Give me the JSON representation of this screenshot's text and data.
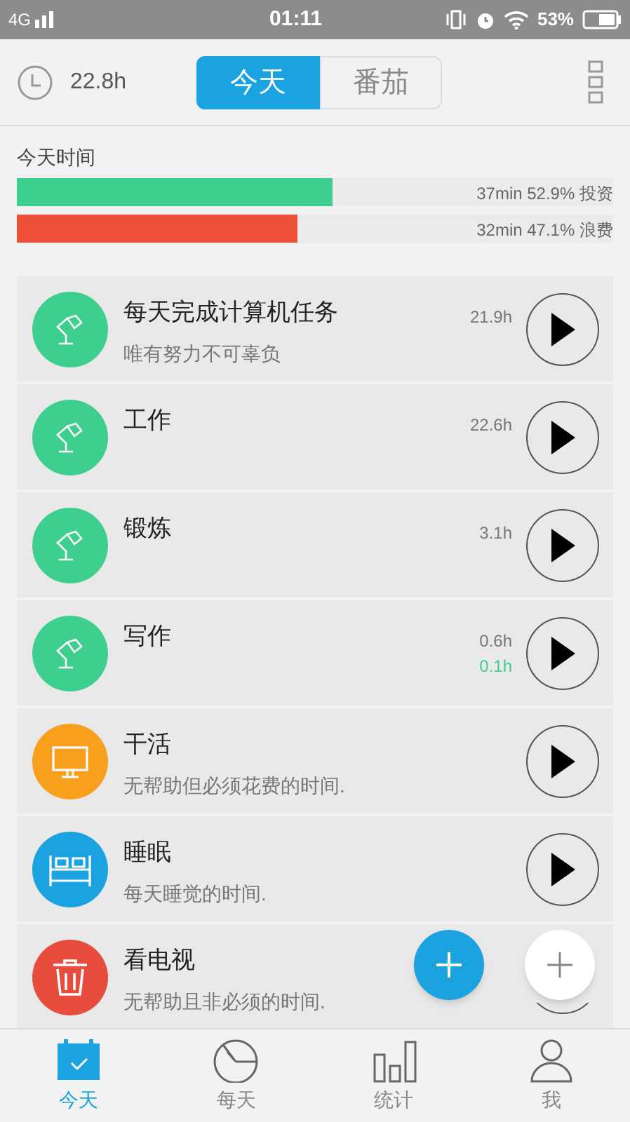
{
  "status_bar": {
    "network": "4G",
    "time": "01:11",
    "battery": "53%"
  },
  "header": {
    "total": "22.8h",
    "tabs": [
      {
        "label": "今天",
        "selected": true
      },
      {
        "label": "番茄",
        "selected": false
      }
    ]
  },
  "summary": {
    "title": "今天时间",
    "bars": [
      {
        "level": 0.529,
        "color": "#3ecf8e",
        "reading": "37min 52.9% 投资"
      },
      {
        "level": 0.471,
        "color": "#ef5138",
        "reading": "32min 47.1% 浪费"
      }
    ]
  },
  "activities": [
    {
      "title": "每天完成计算机任务",
      "subtitle": "唯有努力不可辜负",
      "times": [
        "21.9h"
      ],
      "kind": "lamp",
      "color": "#3ecf8e"
    },
    {
      "title": "工作",
      "times": [
        "22.6h"
      ],
      "kind": "lamp",
      "color": "#3ecf8e"
    },
    {
      "title": "锻炼",
      "times": [
        "3.1h"
      ],
      "kind": "lamp",
      "color": "#3ecf8e"
    },
    {
      "title": "写作",
      "times": [
        "0.6h",
        "0.1h"
      ],
      "kind": "lamp",
      "color": "#3ecf8e"
    },
    {
      "title": "干活",
      "subtitle": "无帮助但必须花费的时间.",
      "kind": "monitor",
      "color": "#f99f1e"
    },
    {
      "title": "睡眠",
      "subtitle": "每天睡觉的时间.",
      "kind": "bed",
      "color": "#1aa3e0"
    },
    {
      "title": "看电视",
      "subtitle": "无帮助且非必须的时间.",
      "kind": "trash",
      "color": "#e84c3d"
    }
  ],
  "nav": [
    {
      "label": "今天",
      "selected": true,
      "kind": "calendar"
    },
    {
      "label": "每天",
      "selected": false,
      "kind": "pie"
    },
    {
      "label": "统计",
      "selected": false,
      "kind": "bars"
    },
    {
      "label": "我",
      "selected": false,
      "kind": "person"
    }
  ]
}
